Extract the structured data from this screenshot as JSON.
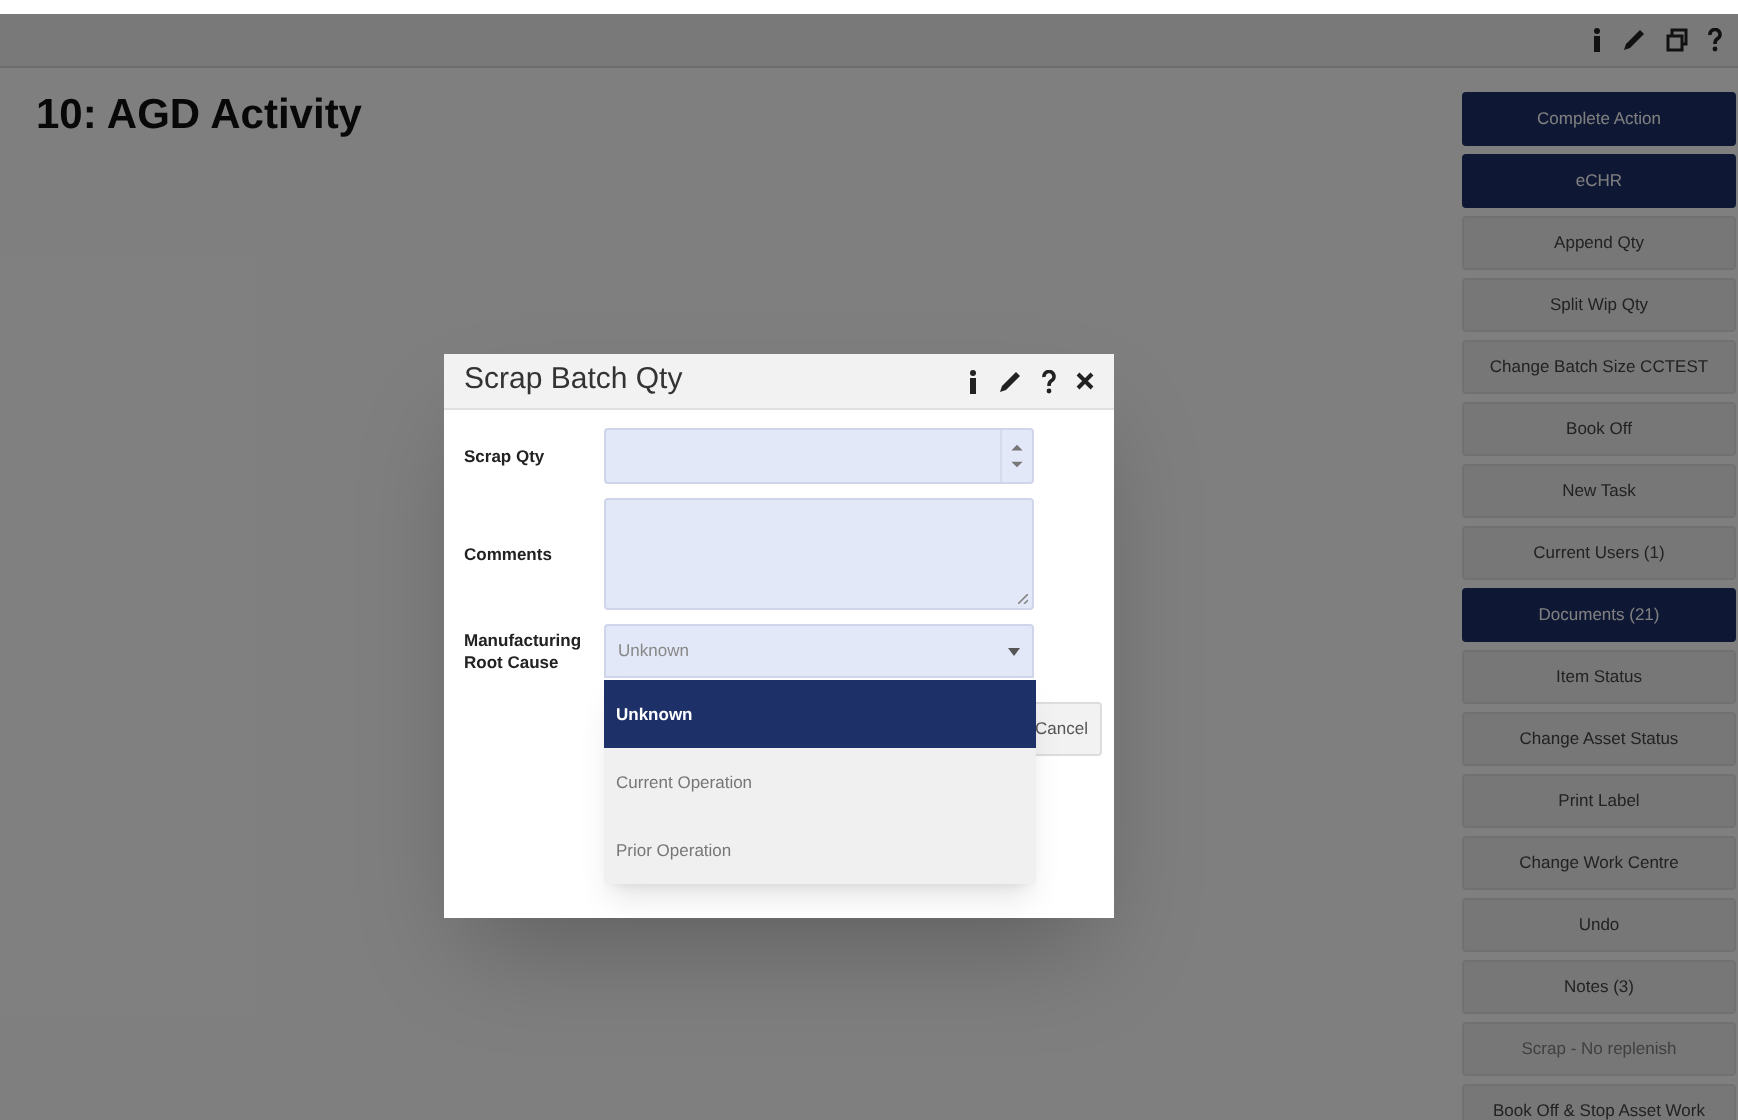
{
  "page": {
    "title": "10: AGD Activity"
  },
  "actions": [
    {
      "label": "Complete Action",
      "kind": "primary",
      "disabled": false
    },
    {
      "label": "eCHR",
      "kind": "primary",
      "disabled": false
    },
    {
      "label": "Append Qty",
      "kind": "default",
      "disabled": false
    },
    {
      "label": "Split Wip Qty",
      "kind": "default",
      "disabled": false
    },
    {
      "label": "Change Batch Size CCTEST",
      "kind": "default",
      "disabled": false
    },
    {
      "label": "Book Off",
      "kind": "default",
      "disabled": false
    },
    {
      "label": "New Task",
      "kind": "default",
      "disabled": false
    },
    {
      "label": "Current Users (1)",
      "kind": "default",
      "disabled": false
    },
    {
      "label": "Documents (21)",
      "kind": "primary",
      "disabled": false
    },
    {
      "label": "Item Status",
      "kind": "default",
      "disabled": false
    },
    {
      "label": "Change Asset Status",
      "kind": "default",
      "disabled": false
    },
    {
      "label": "Print Label",
      "kind": "default",
      "disabled": false
    },
    {
      "label": "Change Work Centre",
      "kind": "default",
      "disabled": false
    },
    {
      "label": "Undo",
      "kind": "default",
      "disabled": false
    },
    {
      "label": "Notes (3)",
      "kind": "default",
      "disabled": false
    },
    {
      "label": "Scrap - No replenish",
      "kind": "default",
      "disabled": true
    },
    {
      "label": "Book Off & Stop Asset Work",
      "kind": "default",
      "disabled": false
    }
  ],
  "dialog": {
    "title": "Scrap Batch Qty",
    "fields": [
      {
        "label": "Scrap Qty",
        "kind": "number"
      },
      {
        "label": "Comments",
        "kind": "textarea"
      },
      {
        "label": "Manufacturing Root Cause",
        "kind": "select",
        "placeholder": "Unknown",
        "expanded": true,
        "options": [
          {
            "label": "Unknown",
            "selected": true
          },
          {
            "label": "Current Operation",
            "selected": false
          },
          {
            "label": "Prior Operation",
            "selected": false
          }
        ]
      }
    ],
    "buttons": [
      {
        "label": "Cancel"
      }
    ]
  }
}
